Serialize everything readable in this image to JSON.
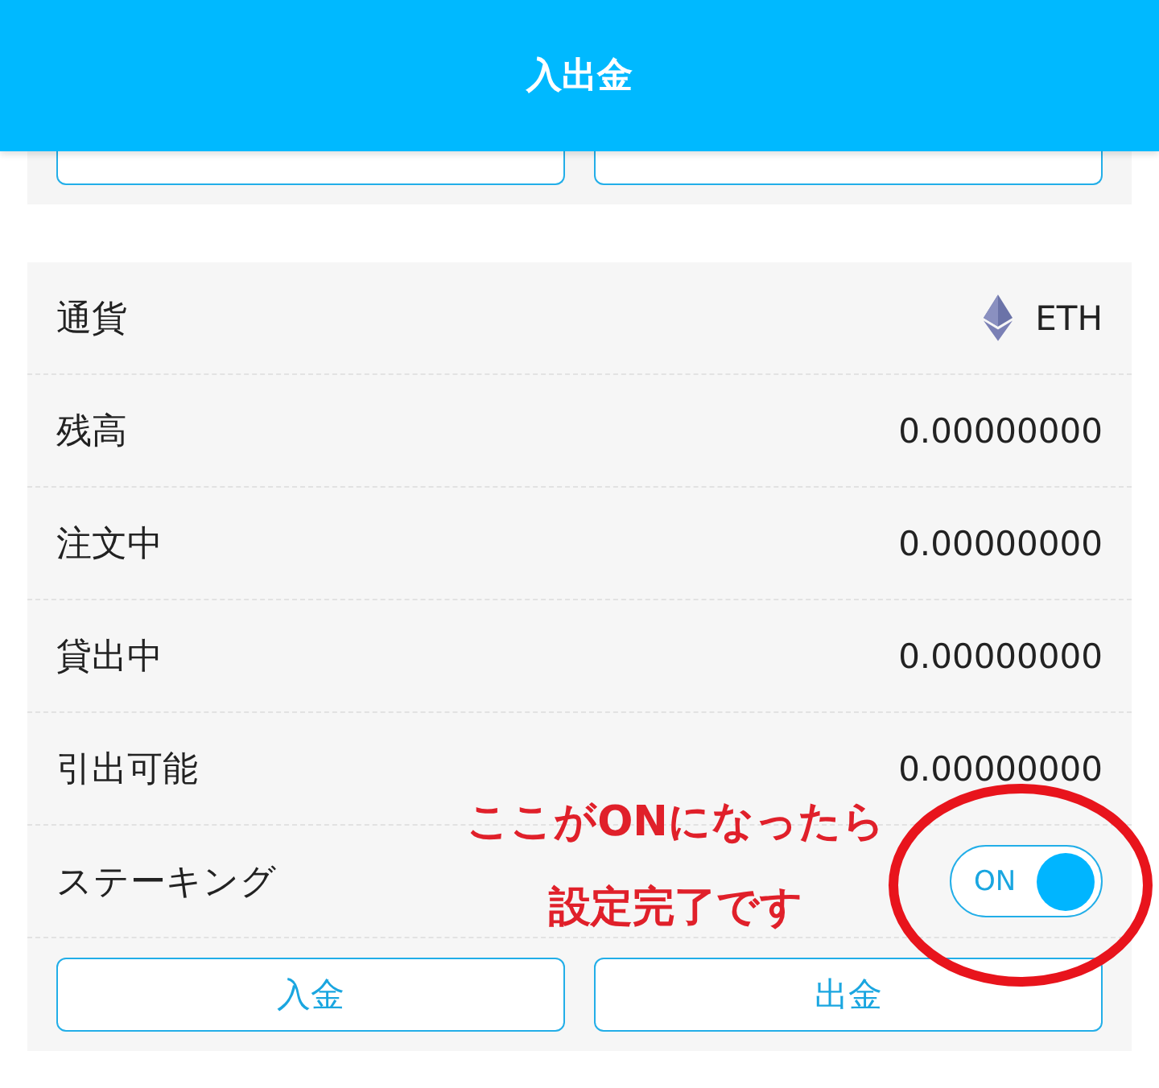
{
  "header": {
    "title": "入出金"
  },
  "top_card": {
    "buttons": [
      {
        "kind": "covered"
      },
      {
        "kind": "covered"
      }
    ]
  },
  "rows": [
    {
      "kind": "currency",
      "label": "通貨",
      "value": "ETH"
    },
    {
      "kind": "value",
      "label": "残高",
      "value": "0.00000000"
    },
    {
      "kind": "value",
      "label": "注文中",
      "value": "0.00000000"
    },
    {
      "kind": "value",
      "label": "貸出中",
      "value": "0.00000000"
    },
    {
      "kind": "value",
      "label": "引出可能",
      "value": "0.00000000"
    },
    {
      "kind": "toggle",
      "label": "ステーキング",
      "on": true,
      "toggle_text": "ON"
    }
  ],
  "buttons": [
    "入金",
    "出金"
  ],
  "annotation": {
    "lines": [
      "ここがONになったら",
      "設定完了です"
    ]
  }
}
